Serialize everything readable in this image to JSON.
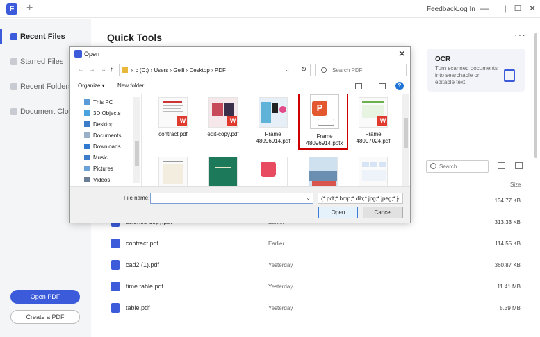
{
  "titlebar": {
    "feedback": "Feedback",
    "login": "Log In",
    "new_tab": "+",
    "minimize": "—",
    "maximize": "☐",
    "close": "✕"
  },
  "sidebar": {
    "items": [
      {
        "label": "Recent Files"
      },
      {
        "label": "Starred Files"
      },
      {
        "label": "Recent Folders"
      },
      {
        "label": "Document Cloud"
      }
    ],
    "open_pdf": "Open PDF",
    "create_pdf": "Create a PDF"
  },
  "main": {
    "title": "Quick Tools",
    "more": "···",
    "ocr": {
      "title": "OCR",
      "desc": "Turn scanned documents into searchable or editable text."
    },
    "search_placeholder": "Search",
    "size_header": "Size",
    "files": [
      {
        "name": "",
        "time": "",
        "size": "134.77 KB"
      },
      {
        "name": "science-copy.pdf",
        "time": "Earlier",
        "size": "313.33 KB"
      },
      {
        "name": "contract.pdf",
        "time": "Earlier",
        "size": "114.55 KB"
      },
      {
        "name": "cad2 (1).pdf",
        "time": "Yesterday",
        "size": "360.87 KB"
      },
      {
        "name": "time table.pdf",
        "time": "Yesterday",
        "size": "11.41 MB"
      },
      {
        "name": "table.pdf",
        "time": "Yesterday",
        "size": "5.39 MB"
      }
    ]
  },
  "dialog": {
    "title": "Open",
    "close": "✕",
    "address": "« c (C:)  ›  Users  ›  Geili  ›  Desktop  ›  PDF",
    "search_placeholder": "Search PDF",
    "organize": "Organize ▾",
    "new_folder": "New folder",
    "help": "?",
    "tree": [
      {
        "label": "This PC",
        "color": "#5a9bd8"
      },
      {
        "label": "3D Objects",
        "color": "#4aa3df"
      },
      {
        "label": "Desktop",
        "color": "#3d7cc9"
      },
      {
        "label": "Documents",
        "color": "#9ab0c8"
      },
      {
        "label": "Downloads",
        "color": "#2f7ad0"
      },
      {
        "label": "Music",
        "color": "#3d7cc9"
      },
      {
        "label": "Pictures",
        "color": "#6aa2d8"
      },
      {
        "label": "Videos",
        "color": "#6a7e96"
      }
    ],
    "files": [
      {
        "label": "contract.pdf",
        "wps": "W"
      },
      {
        "label": "edit-copy.pdf",
        "wps": "W"
      },
      {
        "label": "Frame 48096914.pdf",
        "wps": ""
      },
      {
        "label": "Frame 48096914.pptx",
        "wps": ""
      },
      {
        "label": "Frame 48097024.pdf",
        "wps": "W"
      },
      {
        "label": "",
        "wps": ""
      },
      {
        "label": "",
        "wps": ""
      },
      {
        "label": "",
        "wps": ""
      },
      {
        "label": "",
        "wps": ""
      },
      {
        "label": "",
        "wps": ""
      }
    ],
    "file_name_label": "File name:",
    "file_name_value": "",
    "file_type": "(*.pdf;*.bmp;*.dib;*.jpg;*.jpeg;*.j",
    "open_btn": "Open",
    "cancel_btn": "Cancel"
  }
}
